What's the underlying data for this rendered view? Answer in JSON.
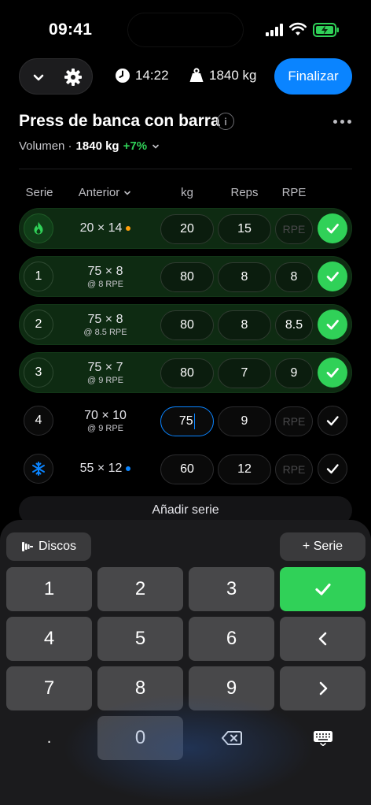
{
  "status": {
    "time": "09:41"
  },
  "toolbar": {
    "duration": "14:22",
    "volume": "1840 kg",
    "finish_label": "Finalizar"
  },
  "exercise": {
    "title": "Press de banca con barra",
    "volume_label": "Volumen · ",
    "volume_value": "1840 kg",
    "volume_change": "+7%"
  },
  "table": {
    "col_set": "Serie",
    "col_prev": "Anterior",
    "col_kg": "kg",
    "col_reps": "Reps",
    "col_rpe": "RPE"
  },
  "sets": [
    {
      "set": "",
      "type": "warmup",
      "prev": "20 × 14",
      "prev_rpe": "",
      "kg": "20",
      "reps": "15",
      "rpe": "RPE",
      "done": true
    },
    {
      "set": "1",
      "type": "normal",
      "prev": "75 × 8",
      "prev_rpe": "@ 8 RPE",
      "kg": "80",
      "reps": "8",
      "rpe": "8",
      "done": true
    },
    {
      "set": "2",
      "type": "normal",
      "prev": "75 × 8",
      "prev_rpe": "@ 8.5 RPE",
      "kg": "80",
      "reps": "8",
      "rpe": "8.5",
      "done": true
    },
    {
      "set": "3",
      "type": "normal",
      "prev": "75 × 7",
      "prev_rpe": "@ 9 RPE",
      "kg": "80",
      "reps": "7",
      "rpe": "9",
      "done": true
    },
    {
      "set": "4",
      "type": "normal",
      "prev": "70 × 10",
      "prev_rpe": "@ 9 RPE",
      "kg": "75",
      "reps": "9",
      "rpe": "RPE",
      "done": false
    },
    {
      "set": "",
      "type": "cooldown",
      "prev": "55 × 12",
      "prev_rpe": "",
      "kg": "60",
      "reps": "12",
      "rpe": "RPE",
      "done": false
    }
  ],
  "add_set_label": "Añadir serie",
  "keyboard": {
    "plates_label": "Discos",
    "add_set_label": "+ Serie",
    "keys": [
      "1",
      "2",
      "3",
      "4",
      "5",
      "6",
      "7",
      "8",
      "9",
      ".",
      "0"
    ]
  },
  "colors": {
    "accent": "#0a84ff",
    "done": "#30d158",
    "warmup": "#30d158",
    "cooldown": "#0a84ff",
    "warm_dot": "#ff9f0a"
  }
}
